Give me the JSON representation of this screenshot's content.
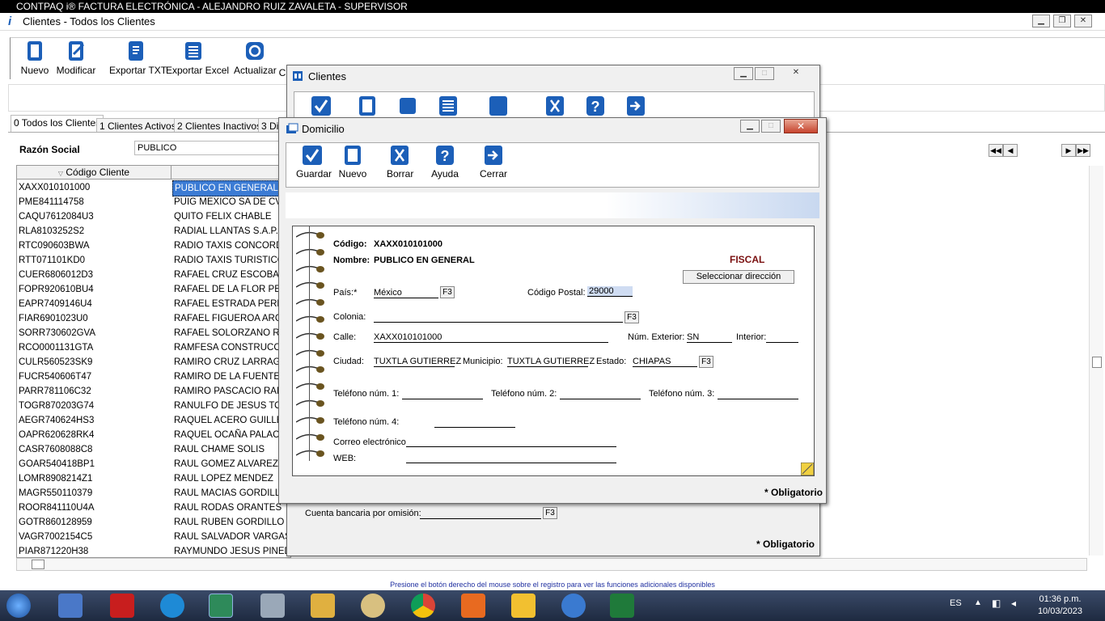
{
  "os_title": "CONTPAQ i® FACTURA ELECTRÓNICA - ALEJANDRO RUIZ ZAVALETA - SUPERVISOR",
  "app_title": "Clientes - Todos los Clientes",
  "main_toolbar": {
    "nuevo": "Nuevo",
    "modificar": "Modificar",
    "exportar_txt": "Exportar TXT",
    "exportar_excel": "Exportar Excel",
    "actualizar": "Actualizar",
    "partial": "C"
  },
  "tabs": [
    "0 Todos los Clientes",
    "1 Clientes Activos",
    "2 Clientes Inactivos",
    "3 Di"
  ],
  "filter": {
    "label": "Razón Social",
    "value": "PUBLICO"
  },
  "grid": {
    "header_codigo": "Código Cliente",
    "rows": [
      {
        "codigo": "XAXX010101000",
        "nombre": "PUBLICO EN GENERAL"
      },
      {
        "codigo": "PME841114758",
        "nombre": "PUIG MEXICO SA DE CV"
      },
      {
        "codigo": "CAQU7612084U3",
        "nombre": "QUITO FELIX CHABLE"
      },
      {
        "codigo": "RLA8103252S2",
        "nombre": "RADIAL LLANTAS S.A.P.I."
      },
      {
        "codigo": "RTC090603BWA",
        "nombre": "RADIO TAXIS CONCORD"
      },
      {
        "codigo": "RTT071101KD0",
        "nombre": "RADIO TAXIS TURISTICO"
      },
      {
        "codigo": "CUER6806012D3",
        "nombre": "RAFAEL CRUZ ESCOBAR"
      },
      {
        "codigo": "FOPR920610BU4",
        "nombre": "RAFAEL DE LA FLOR PER"
      },
      {
        "codigo": "EAPR7409146U4",
        "nombre": "RAFAEL ESTRADA PEREZ"
      },
      {
        "codigo": "FIAR6901023U0",
        "nombre": "RAFAEL FIGUEROA ARG"
      },
      {
        "codigo": "SORR730602GVA",
        "nombre": "RAFAEL SOLORZANO RU"
      },
      {
        "codigo": "RCO0001131GTA",
        "nombre": "RAMFESA CONSTRUCCIO"
      },
      {
        "codigo": "CULR560523SK9",
        "nombre": "RAMIRO CRUZ LARRAGA"
      },
      {
        "codigo": "FUCR540606T47",
        "nombre": "RAMIRO DE LA FUENTE"
      },
      {
        "codigo": "PARR781106C32",
        "nombre": "RAMIRO PASCACIO RAMI"
      },
      {
        "codigo": "TOGR870203G74",
        "nombre": "RANULFO DE JESUS TOL"
      },
      {
        "codigo": "AEGR740624HS3",
        "nombre": "RAQUEL ACERO GUILLEN"
      },
      {
        "codigo": "OAPR620628RK4",
        "nombre": "RAQUEL OCAÑA PALACIO"
      },
      {
        "codigo": "CASR7608088C8",
        "nombre": "RAUL CHAME SOLIS"
      },
      {
        "codigo": "GOAR540418BP1",
        "nombre": "RAUL GOMEZ ALVAREZ"
      },
      {
        "codigo": "LOMR8908214Z1",
        "nombre": "RAUL LOPEZ MENDEZ"
      },
      {
        "codigo": "MAGR550110379",
        "nombre": "RAUL MACIAS GORDILLO"
      },
      {
        "codigo": "ROOR841110U4A",
        "nombre": "RAUL RODAS ORANTES"
      },
      {
        "codigo": "GOTR860128959",
        "nombre": "RAUL RUBEN GORDILLO T"
      },
      {
        "codigo": "VAGR7002154C5",
        "nombre": "RAUL SALVADOR VARGAS"
      },
      {
        "codigo": "PIAR871220H38",
        "nombre": "RAYMUNDO JESUS PINEDA"
      }
    ]
  },
  "status_hint": "Presione el botón derecho del mouse sobre el registro para ver las funciones adicionales disponibles",
  "clientes_dialog": {
    "title": "Clientes",
    "cuenta_label": "Cuenta bancaria por omisión:",
    "f3": "F3",
    "obligatorio": "* Obligatorio"
  },
  "domicilio_dialog": {
    "title": "Domicilio",
    "toolbar": {
      "guardar": "Guardar",
      "nuevo": "Nuevo",
      "borrar": "Borrar",
      "ayuda": "Ayuda",
      "cerrar": "Cerrar"
    },
    "codigo_label": "Código:",
    "codigo_value": "XAXX010101000",
    "nombre_label": "Nombre:",
    "nombre_value": "PUBLICO EN GENERAL",
    "fiscal": "FISCAL",
    "seleccionar": "Seleccionar dirección",
    "pais_label": "País:*",
    "pais_value": "México",
    "cp_label": "Código Postal:",
    "cp_value": "29000",
    "colonia_label": "Colonia:",
    "colonia_value": "",
    "calle_label": "Calle:",
    "calle_value": "XAXX010101000",
    "num_ext_label": "Núm. Exterior:",
    "num_ext_value": "SN",
    "interior_label": "Interior:",
    "interior_value": "",
    "ciudad_label": "Ciudad:",
    "ciudad_value": "TUXTLA GUTIERREZ",
    "municipio_label": "Municipio:",
    "municipio_value": "TUXTLA GUTIERREZ",
    "estado_label": "Estado:",
    "estado_value": "CHIAPAS",
    "tel1_label": "Teléfono núm. 1:",
    "tel2_label": "Teléfono núm. 2:",
    "tel3_label": "Teléfono núm. 3:",
    "tel4_label": "Teléfono núm. 4:",
    "correo_label": "Correo electrónico",
    "web_label": "WEB:",
    "f3": "F3",
    "obligatorio": "* Obligatorio"
  },
  "taskbar": {
    "lang": "ES",
    "time": "01:36 p.m.",
    "date": "10/03/2023"
  },
  "colors": {
    "accent": "#1c5fb8",
    "selection": "#3b7bd4",
    "fiscal": "#7a1010"
  }
}
